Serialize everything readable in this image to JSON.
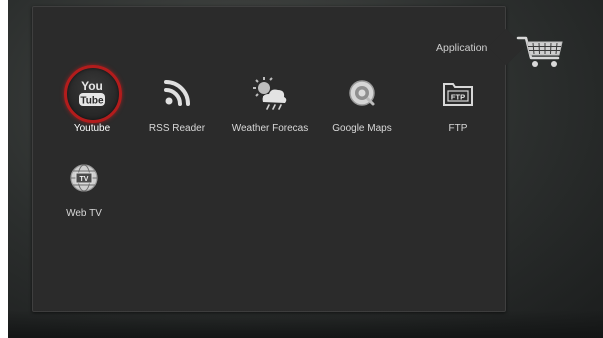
{
  "header": {
    "section_title": "Application"
  },
  "side_tab": {
    "icon": "shopping-cart-icon"
  },
  "apps": [
    {
      "label": "Youtube",
      "icon": "youtube-icon",
      "selected": true
    },
    {
      "label": "RSS Reader",
      "icon": "rss-icon",
      "selected": false
    },
    {
      "label": "Weather Forecas",
      "icon": "weather-icon",
      "selected": false
    },
    {
      "label": "Google Maps",
      "icon": "google-maps-icon",
      "selected": false
    },
    {
      "label": "FTP",
      "icon": "ftp-folder-icon",
      "selected": false
    },
    {
      "label": "Web TV",
      "icon": "web-tv-globe-icon",
      "selected": false
    }
  ],
  "colors": {
    "panel": "#2b2b2b",
    "selection_ring": "#b31c1c",
    "label_text": "#d8d8d8"
  }
}
